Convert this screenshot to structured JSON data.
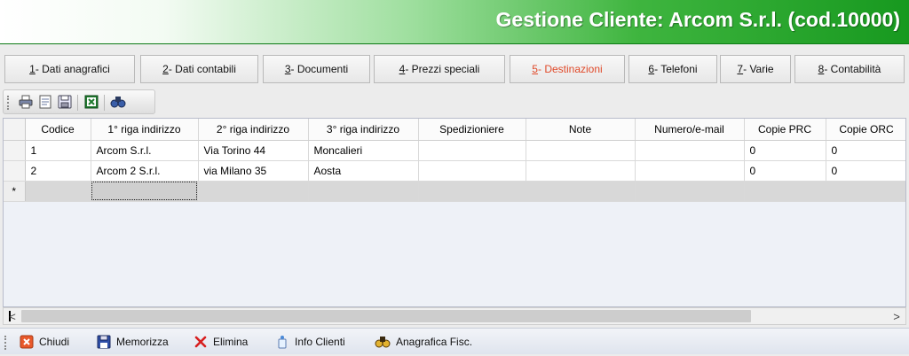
{
  "window": {
    "title": "Gestione Cliente: Arcom S.r.l. (cod.10000)"
  },
  "colors": {
    "title_green": "#17991f",
    "active_tab": "#e04a2a",
    "grid_bg": "#eef1f7"
  },
  "tabs": [
    {
      "key": "1",
      "label": " - Dati anagrafici"
    },
    {
      "key": "2",
      "label": " - Dati contabili"
    },
    {
      "key": "3",
      "label": " - Documenti"
    },
    {
      "key": "4",
      "label": " - Prezzi speciali"
    },
    {
      "key": "5",
      "label": " - Destinazioni",
      "active": true
    },
    {
      "key": "6",
      "label": " - Telefoni"
    },
    {
      "key": "7",
      "label": " - Varie"
    },
    {
      "key": "8",
      "label": " - Contabilità"
    }
  ],
  "toolbar": {
    "icons": [
      "print-icon",
      "print-preview-icon",
      "save-icon",
      "excel-export-icon",
      "find-icon"
    ]
  },
  "grid": {
    "columns": [
      "Codice",
      "1° riga indirizzo",
      "2° riga indirizzo",
      "3° riga indirizzo",
      "Spedizioniere",
      "Note",
      "Numero/e-mail",
      "Copie PRC",
      "Copie ORC"
    ],
    "rows": [
      [
        "1",
        "Arcom S.r.l.",
        "Via Torino 44",
        "Moncalieri",
        "",
        "",
        "",
        "0",
        "0"
      ],
      [
        "2",
        "Arcom 2 S.r.l.",
        "via Milano 35",
        "Aosta",
        "",
        "",
        "",
        "0",
        "0"
      ]
    ],
    "new_row_marker": "*"
  },
  "scrollbar": {
    "left_arrow": "<",
    "right_arrow": ">"
  },
  "bottom_toolbar": {
    "close": "Chiudi",
    "save": "Memorizza",
    "delete": "Elimina",
    "info": "Info Clienti",
    "fiscal": "Anagrafica Fisc."
  }
}
